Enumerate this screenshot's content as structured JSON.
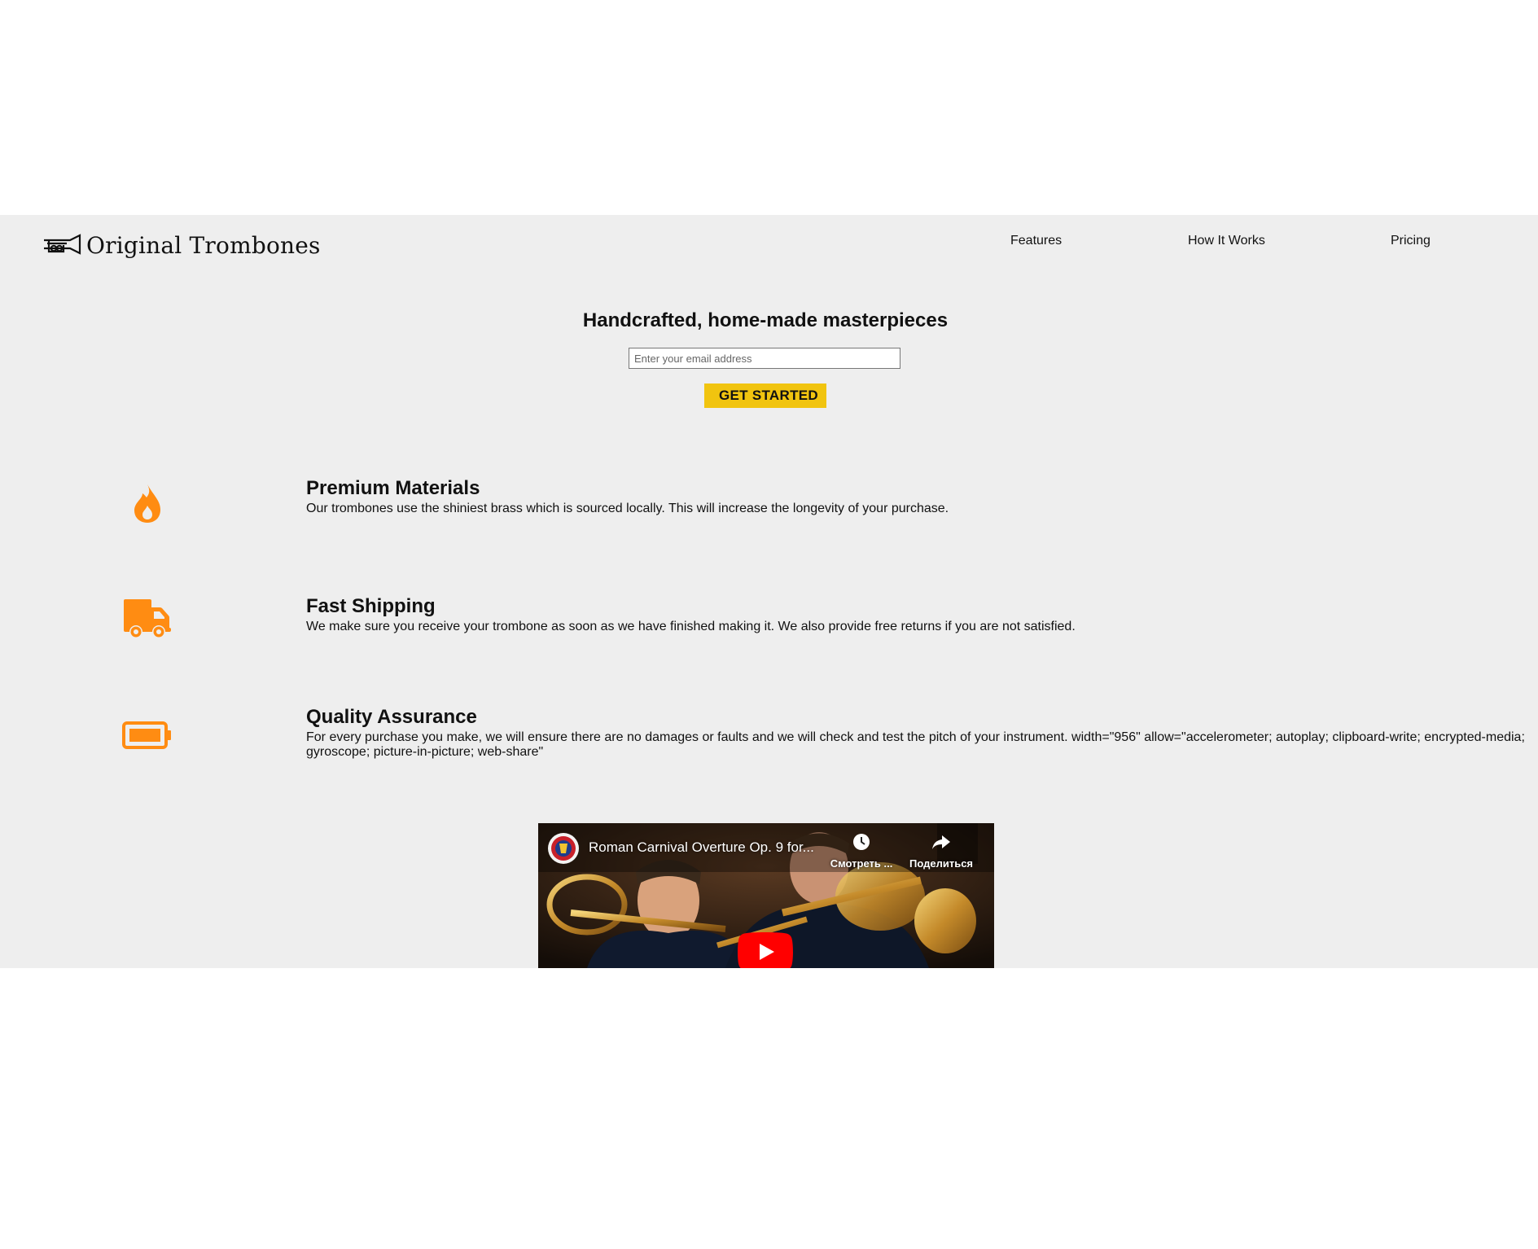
{
  "header": {
    "logo_text": "Original Trombones",
    "nav": [
      {
        "label": "Features"
      },
      {
        "label": "How It Works"
      },
      {
        "label": "Pricing"
      }
    ]
  },
  "hero": {
    "title": "Handcrafted, home-made masterpieces",
    "email_placeholder": "Enter your email address",
    "cta_label": "GET STARTED"
  },
  "features": [
    {
      "icon": "fire-icon",
      "title": "Premium Materials",
      "description": "Our trombones use the shiniest brass which is sourced locally. This will increase the longevity of your purchase."
    },
    {
      "icon": "truck-icon",
      "title": "Fast Shipping",
      "description": "We make sure you receive your trombone as soon as we have finished making it. We also provide free returns if you are not satisfied."
    },
    {
      "icon": "battery-icon",
      "title": "Quality Assurance",
      "description": "For every purchase you make, we will ensure there are no damages or faults and we will check and test the pitch of your instrument. width=\"956\" allow=\"accelerometer; autoplay; clipboard-write; encrypted-media; gyroscope; picture-in-picture; web-share\""
    }
  ],
  "video": {
    "title": "Roman Carnival Overture Op. 9 for...",
    "watch_later_label": "Смотреть ...",
    "share_label": "Поделиться"
  },
  "colors": {
    "accent": "#f1c40f",
    "icon": "#ff8c12",
    "background": "#eeeeee"
  }
}
